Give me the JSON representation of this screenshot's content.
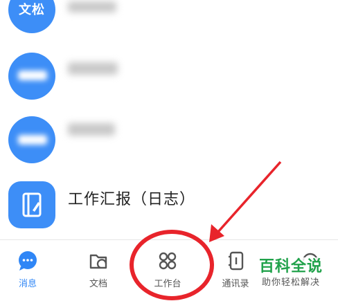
{
  "chats": [
    {
      "avatar_text": "文松",
      "name": ""
    },
    {
      "avatar_text": "",
      "name": ""
    },
    {
      "avatar_text": "",
      "name": ""
    },
    {
      "avatar_text": "",
      "name": "工作汇报（日志）"
    }
  ],
  "tabbar": {
    "tabs": [
      {
        "label": "消息",
        "icon": "chat-bubble-icon",
        "active": true
      },
      {
        "label": "文档",
        "icon": "folder-icon"
      },
      {
        "label": "工作台",
        "icon": "grid-icon"
      },
      {
        "label": "通讯录",
        "icon": "contacts-book-icon"
      }
    ]
  },
  "colors": {
    "accent": "#2f86f6",
    "avatar": "#3d8ef7",
    "annotation": "#e8242b",
    "watermark": "#21a24b"
  },
  "watermark": {
    "title": "百科全说",
    "subtitle": "助你轻松解决"
  }
}
